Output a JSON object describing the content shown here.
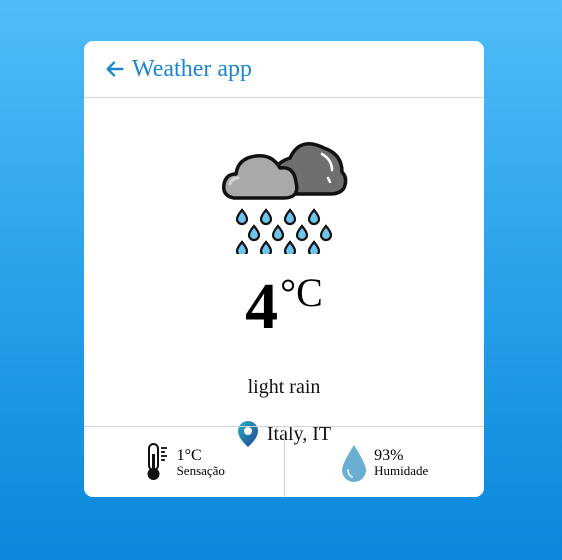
{
  "header": {
    "title": "Weather app",
    "back_icon": "arrow-left-icon"
  },
  "weather": {
    "icon": "cloud-rain-icon",
    "temperature": "4",
    "unit": "°C",
    "description": "light rain"
  },
  "location": {
    "icon": "map-pin-icon",
    "text": "Italy, IT"
  },
  "stats": {
    "feels_like": {
      "icon": "thermometer-icon",
      "value": "1°C",
      "label": "Sensação"
    },
    "humidity": {
      "icon": "water-drop-icon",
      "value": "93%",
      "label": "Humidade"
    }
  },
  "colors": {
    "accent": "#1d86cd",
    "background_top": "#4fbdf7",
    "background_bottom": "#0b88da",
    "card": "#ffffff",
    "divider": "#cfd3d6"
  }
}
